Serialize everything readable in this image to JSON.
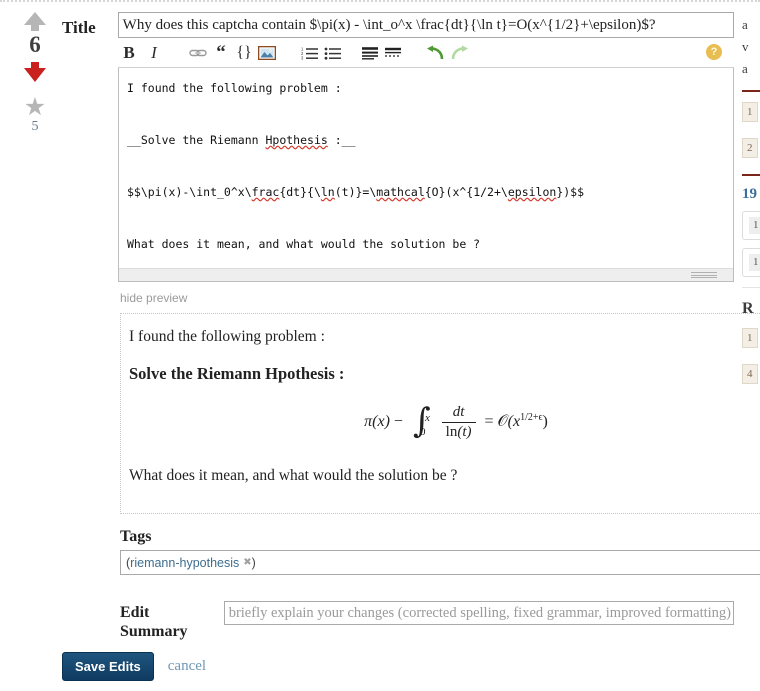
{
  "votes": {
    "upvote_icon": "arrow-up-icon",
    "score": "6",
    "downvote_icon": "arrow-down-icon",
    "favorite_icon": "star-icon",
    "favorite_count": "5"
  },
  "form": {
    "title_label": "Title",
    "title_value": "Why does this captcha contain $\\pi(x) - \\int_o^x \\frac{dt}{\\ln t}=O(x^{1/2}+\\epsilon)$?",
    "toolbar": {
      "bold_label": "B",
      "italic_label": "I",
      "link_icon": "link-icon",
      "quote_label": "“",
      "code_label": "{}",
      "image_icon": "image-icon",
      "numbered_list_icon": "numbered-list-icon",
      "bullet_list_icon": "bullet-list-icon",
      "heading_icon": "heading-icon",
      "hr_icon": "horizontal-rule-icon",
      "undo_icon": "undo-arrow-icon",
      "redo_icon": "redo-arrow-icon",
      "help_label": "?"
    },
    "body_lines": [
      "I found the following problem :",
      "__Solve the Riemann Hpothesis :__",
      "$$\\pi(x)-\\int_0^x\\frac{dt}{\\ln(t)}=\\mathcal{O}(x^{1/2+\\epsilon})$$",
      "What does it mean, and what would the solution be ?"
    ],
    "misspelled_words": [
      "Hpothesis",
      "frac",
      "ln",
      "mathcal",
      "epsilon"
    ],
    "hide_preview_label": "hide preview",
    "preview": {
      "paragraph_1": "I found the following problem :",
      "heading": "Solve the Riemann Hpothesis :",
      "math": {
        "pi_of_x": "π(x)",
        "minus": "−",
        "integral_sign": "∫",
        "lower_limit": "0",
        "upper_limit": "x",
        "numerator": "dt",
        "denominator_fn": "ln",
        "denominator_arg": "(t)",
        "equals": "=",
        "big_o": "𝒪",
        "rhs_base": "(x",
        "rhs_exponent": "1/2+ϵ",
        "rhs_close": ")"
      },
      "paragraph_2": "What does it mean, and what would the solution be ?"
    },
    "tags_label": "Tags",
    "tags_open_paren": "(",
    "tags": [
      {
        "name": "riemann-hypothesis",
        "remove_icon": "✖"
      }
    ],
    "tags_close_paren": ")",
    "summary_label_line1": "Edit",
    "summary_label_line2": "Summary",
    "summary_placeholder": "briefly explain your changes (corrected spelling, fixed grammar, improved formatting)",
    "summary_value": "",
    "save_label": "Save Edits",
    "cancel_label": "cancel"
  },
  "sidebar": {
    "stats": [
      "a",
      "v",
      "a"
    ],
    "linked_items": [
      "1",
      "2"
    ],
    "related_count": "19",
    "cards": [
      "1",
      "1"
    ],
    "related_heading": "R",
    "related_items": [
      "1",
      "4"
    ]
  },
  "colors": {
    "downvote_red": "#c9211e",
    "upvote_gray": "#b6b6b6",
    "save_button_navy": "#12436c",
    "link_blue": "#3e6d8e",
    "help_yellow": "#e8bd52",
    "spellcheck_red": "#d33a2c",
    "sidebar_rule_maroon": "#7a2518"
  }
}
